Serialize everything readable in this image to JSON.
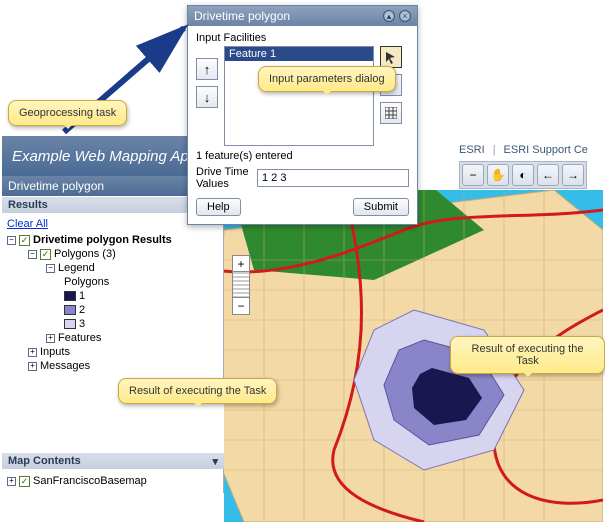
{
  "app": {
    "title": "Example Web Mapping App"
  },
  "sidebar": {
    "panel_title": "Drivetime polygon",
    "results_label": "Results",
    "clear_all": "Clear All",
    "root": "Drivetime polygon Results",
    "polygons_label": "Polygons (3)",
    "legend_label": "Legend",
    "legend_sub": "Polygons",
    "series": [
      {
        "label": "1",
        "color": "#1a1650"
      },
      {
        "label": "2",
        "color": "#8a84c8"
      },
      {
        "label": "3",
        "color": "#d6d4ee"
      }
    ],
    "features": "Features",
    "inputs": "Inputs",
    "messages": "Messages"
  },
  "map_contents": {
    "title": "Map Contents",
    "layer": "SanFranciscoBasemap"
  },
  "dialog": {
    "title": "Drivetime polygon",
    "input_facilities": "Input Facilities",
    "feature_selected": "Feature 1",
    "features_entered": "1 feature(s) entered",
    "drive_time_label": "Drive Time Values",
    "drive_time_value": "1 2 3",
    "help": "Help",
    "submit": "Submit"
  },
  "toolbar_links": {
    "esri": "ESRI",
    "support": "ESRI Support Ce"
  },
  "map_tools": {
    "zoom_in": "−",
    "pan": "✋",
    "zoom_ext": "◐",
    "back": "←",
    "fwd": "→"
  },
  "callouts": {
    "geoproc": "Geoprocessing task",
    "params": "Input parameters dialog",
    "result_left": "Result of executing the Task",
    "result_right": "Result of executing the Task"
  }
}
